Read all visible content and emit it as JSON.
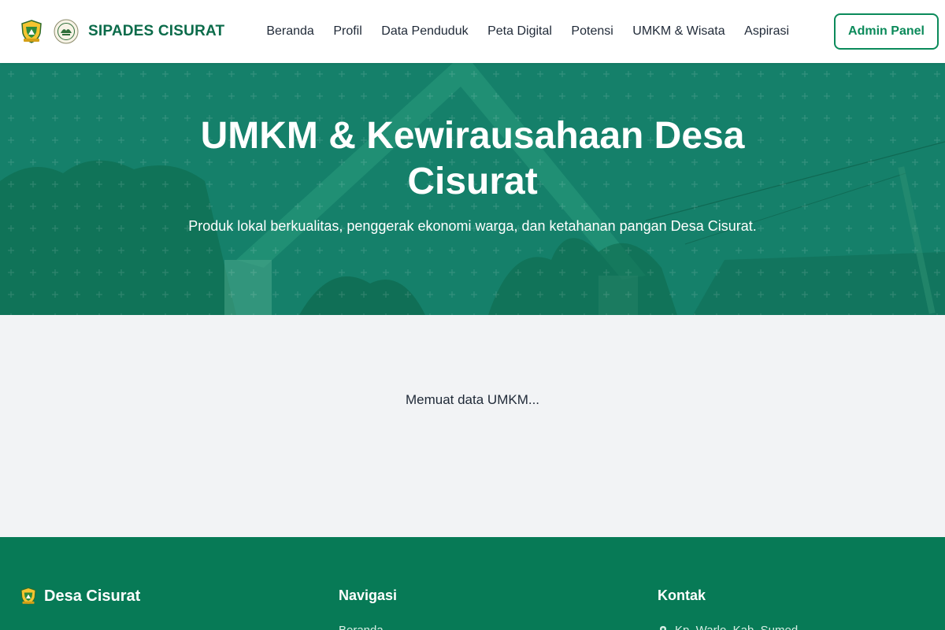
{
  "header": {
    "brand": "SIPADES CISURAT",
    "logo_icons": [
      "regency-emblem-icon",
      "village-seal-icon"
    ],
    "nav": [
      {
        "label": "Beranda"
      },
      {
        "label": "Profil"
      },
      {
        "label": "Data Penduduk"
      },
      {
        "label": "Peta Digital"
      },
      {
        "label": "Potensi"
      },
      {
        "label": "UMKM & Wisata"
      },
      {
        "label": "Aspirasi"
      }
    ],
    "admin_button": "Admin Panel"
  },
  "hero": {
    "title": "UMKM & Kewirausahaan Desa Cisurat",
    "subtitle": "Produk lokal berkualitas, penggerak ekonomi warga, dan ketahanan pangan Desa Cisurat."
  },
  "main": {
    "loading_text": "Memuat data UMKM..."
  },
  "footer": {
    "brand": "Desa Cisurat",
    "nav_title": "Navigasi",
    "nav_first_link": "Beranda",
    "contact_title": "Kontak",
    "contact_first_line": "Kp. Warlo, Kab. Sumed"
  },
  "colors": {
    "brand_green": "#0b6b4a",
    "accent_green": "#0b8a5a",
    "hero_overlay": "#16806a",
    "footer_bg": "#077a56",
    "page_bg": "#f2f3f5"
  }
}
